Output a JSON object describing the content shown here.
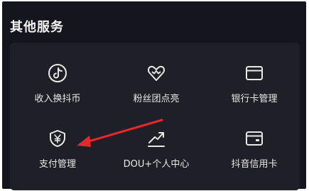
{
  "section": {
    "title": "其他服务"
  },
  "services": [
    {
      "label": "收入换抖币",
      "icon": "tiktok-coin-icon"
    },
    {
      "label": "粉丝团点亮",
      "icon": "fan-badge-icon"
    },
    {
      "label": "银行卡管理",
      "icon": "bank-card-icon"
    },
    {
      "label": "支付管理",
      "icon": "yuan-shield-icon"
    },
    {
      "label": "DOU+个人中心",
      "icon": "trend-up-icon"
    },
    {
      "label": "抖音信用卡",
      "icon": "credit-card-icon"
    }
  ],
  "annotation": {
    "color": "#e8262b"
  }
}
